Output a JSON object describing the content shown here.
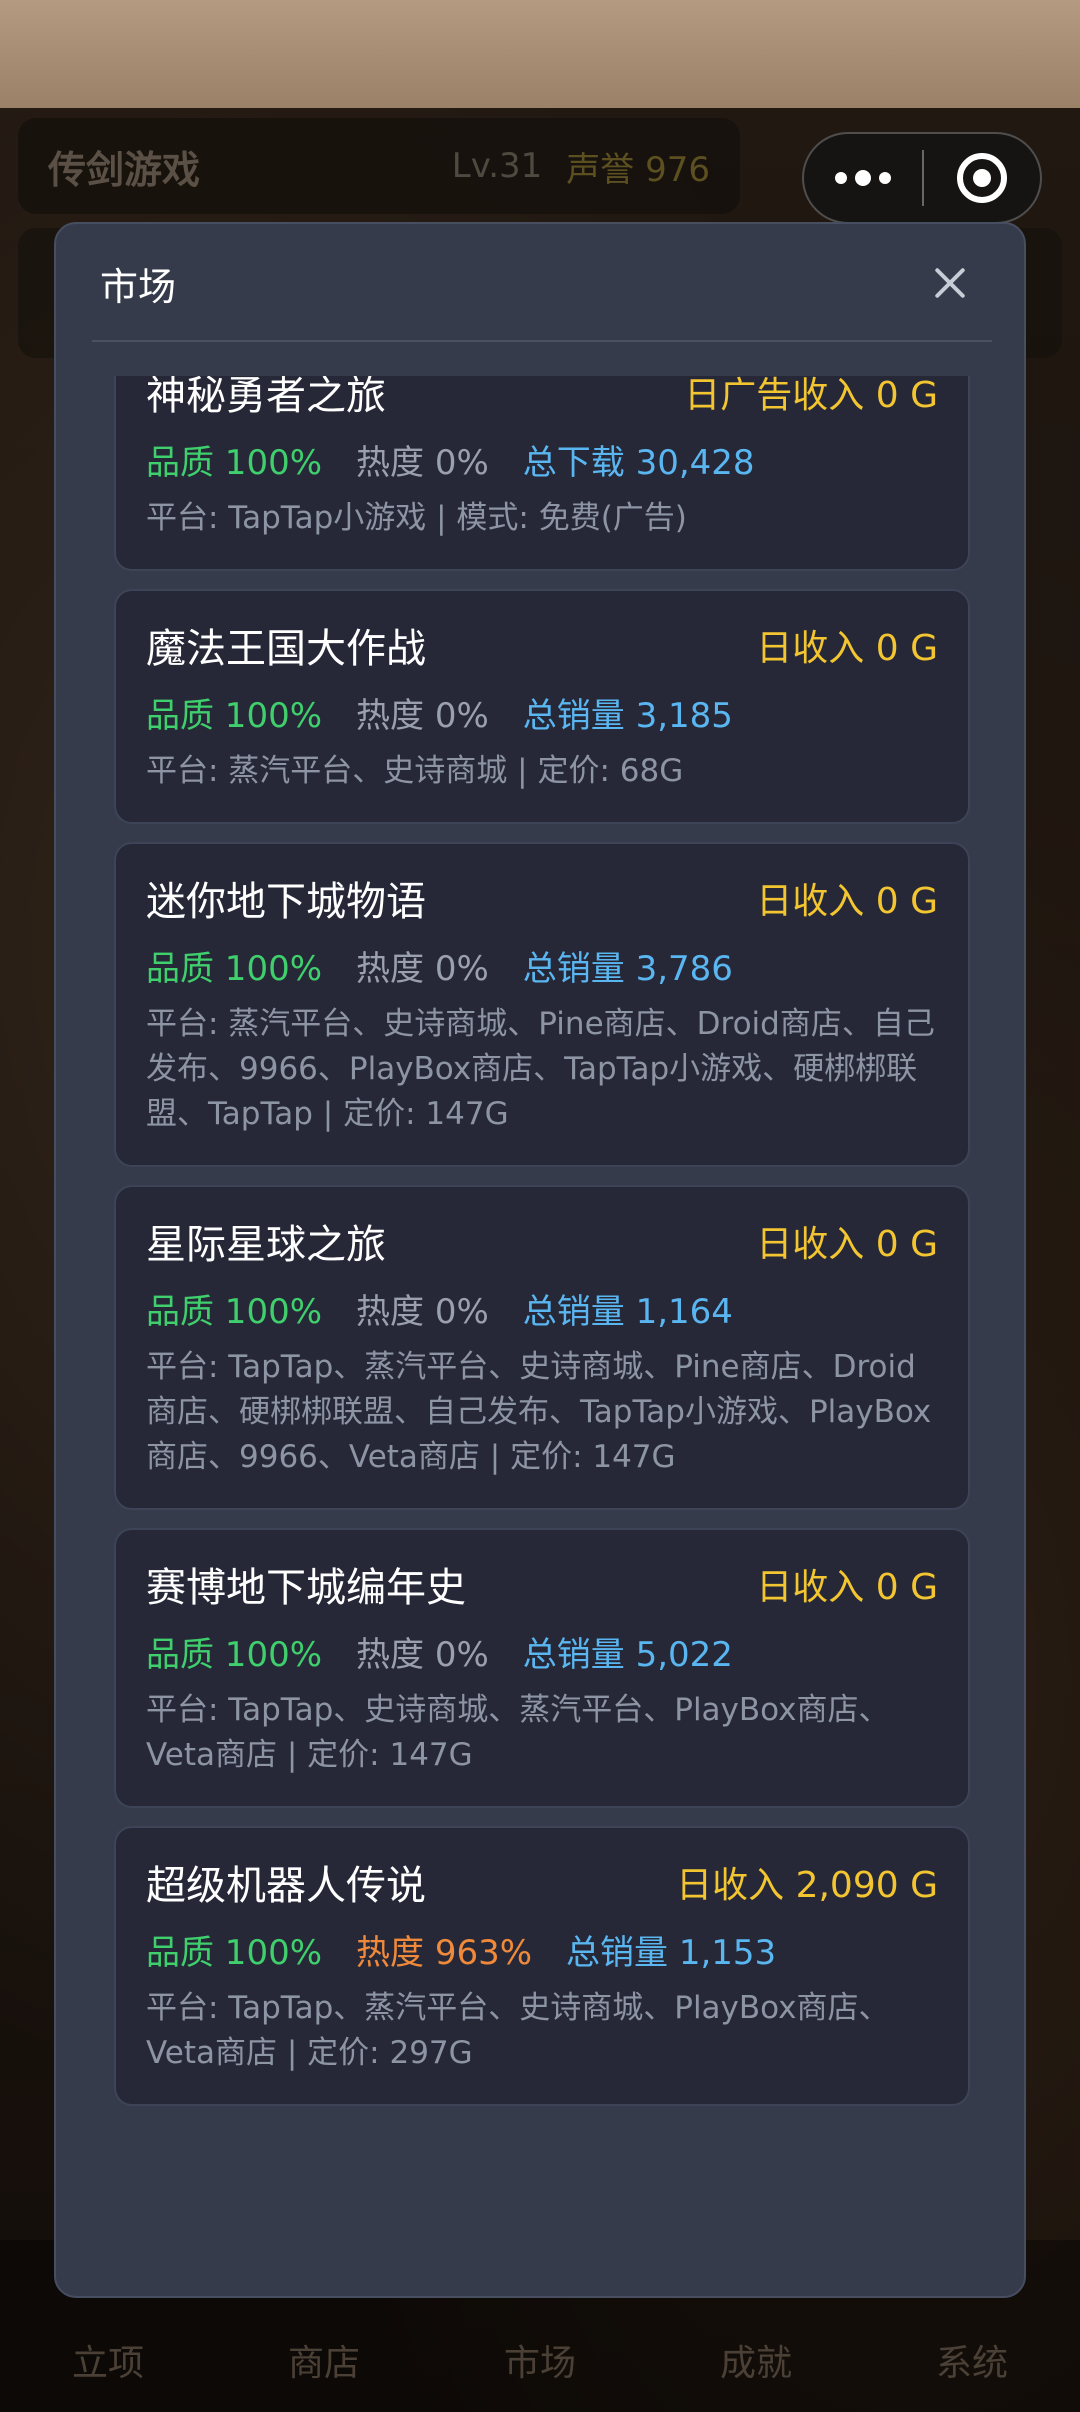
{
  "background": {
    "hud_title": "传剑游戏",
    "hud_level": "Lv.31",
    "hud_reputation": "声誉 976",
    "nav": [
      "立项",
      "商店",
      "市场",
      "成就",
      "系统"
    ]
  },
  "modal": {
    "title": "市场",
    "games": [
      {
        "name": "神秘勇者之旅",
        "income": "日广告收入 0 G",
        "quality": "品质 100%",
        "heat": "热度 0%",
        "sales": "总下载 30,428",
        "detail": "平台: TapTap小游戏 | 模式: 免费(广告)"
      },
      {
        "name": "魔法王国大作战",
        "income": "日收入 0 G",
        "quality": "品质 100%",
        "heat": "热度 0%",
        "sales": "总销量 3,185",
        "detail": "平台: 蒸汽平台、史诗商城 | 定价: 68G"
      },
      {
        "name": "迷你地下城物语",
        "income": "日收入 0 G",
        "quality": "品质 100%",
        "heat": "热度 0%",
        "sales": "总销量 3,786",
        "detail": "平台: 蒸汽平台、史诗商城、Pine商店、Droid商店、自己发布、9966、PlayBox商店、TapTap小游戏、硬梆梆联盟、TapTap | 定价: 147G"
      },
      {
        "name": "星际星球之旅",
        "income": "日收入 0 G",
        "quality": "品质 100%",
        "heat": "热度 0%",
        "sales": "总销量 1,164",
        "detail": "平台: TapTap、蒸汽平台、史诗商城、Pine商店、Droid商店、硬梆梆联盟、自己发布、TapTap小游戏、PlayBox商店、9966、Veta商店 | 定价: 147G"
      },
      {
        "name": "赛博地下城编年史",
        "income": "日收入 0 G",
        "quality": "品质 100%",
        "heat": "热度 0%",
        "sales": "总销量 5,022",
        "detail": "平台: TapTap、史诗商城、蒸汽平台、PlayBox商店、Veta商店 | 定价: 147G"
      },
      {
        "name": "超级机器人传说",
        "income": "日收入 2,090 G",
        "quality": "品质 100%",
        "heat": "热度 963%",
        "heat_hot": true,
        "sales": "总销量 1,153",
        "detail": "平台: TapTap、蒸汽平台、史诗商城、PlayBox商店、Veta商店 | 定价: 297G"
      }
    ]
  },
  "colors": {
    "modal_bg": "#353b4b",
    "card_bg": "#262838",
    "income": "#f2c531",
    "quality": "#3fcf6c",
    "heat": "#9aa0ad",
    "heat_hot": "#f08a3a",
    "sales": "#5ab6f0"
  }
}
